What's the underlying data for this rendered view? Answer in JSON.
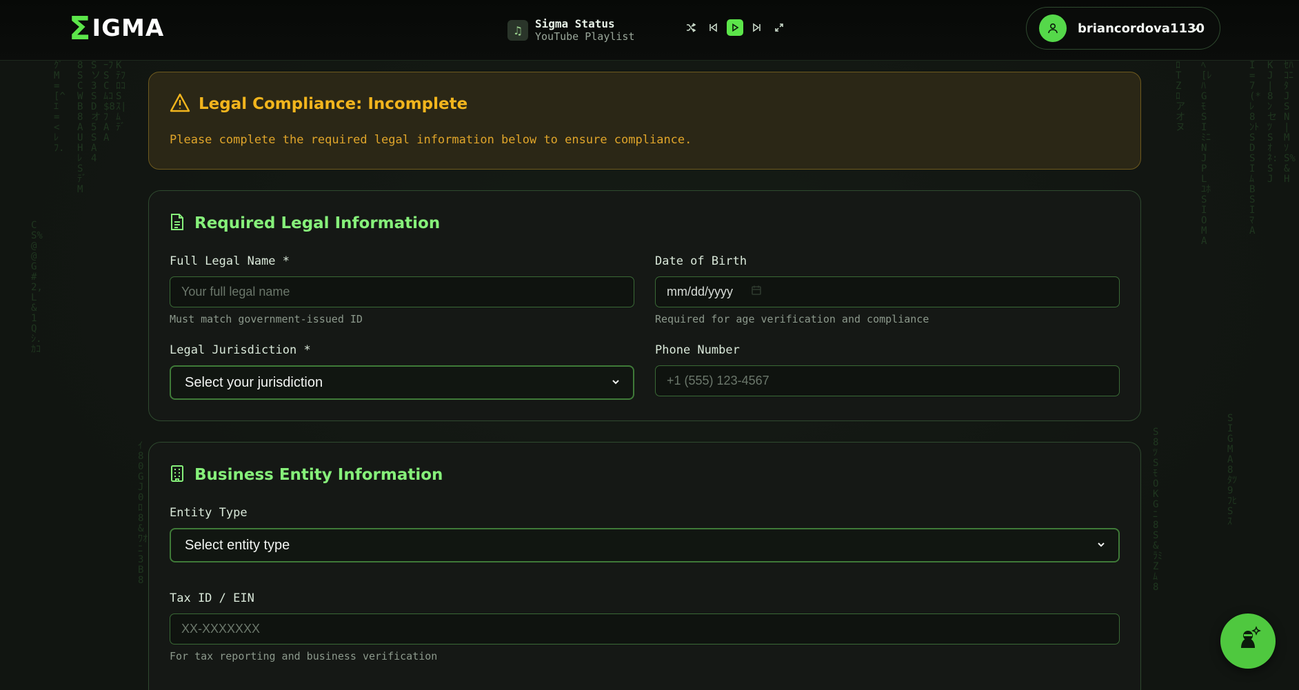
{
  "brand": {
    "sigma_glyph": "Σ",
    "text": "IGMA"
  },
  "player": {
    "title": "Sigma Status",
    "subtitle": "YouTube Playlist",
    "thumb_icon": "music-note-icon",
    "controls": [
      "shuffle-icon",
      "skip-back-icon",
      "play-icon",
      "skip-forward-icon",
      "expand-icon"
    ]
  },
  "user": {
    "name": "briancordova1130"
  },
  "alert": {
    "title": "Legal Compliance: Incomplete",
    "text": "Please complete the required legal information below to ensure compliance.",
    "color": "#f2b51d"
  },
  "legal_section": {
    "title": "Required Legal Information",
    "full_name": {
      "label": "Full Legal Name *",
      "placeholder": "Your full legal name",
      "hint": "Must match government-issued ID"
    },
    "dob": {
      "label": "Date of Birth",
      "value": "mm/dd/yyyy",
      "hint": "Required for age verification and compliance"
    },
    "jurisdiction": {
      "label": "Legal Jurisdiction *",
      "value": "Select your jurisdiction"
    },
    "phone": {
      "label": "Phone Number",
      "placeholder": "+1 (555) 123-4567"
    }
  },
  "business_section": {
    "title": "Business Entity Information",
    "entity_type": {
      "label": "Entity Type",
      "value": "Select entity type"
    },
    "tax_id": {
      "label": "Tax ID / EIN",
      "placeholder": "XX-XXXXXXX",
      "hint": "For tax reporting and business verification"
    }
  },
  "theme": {
    "accent": "#5ce64a",
    "card_border": "#2f4a2f",
    "warning": "#f2b51d"
  }
}
